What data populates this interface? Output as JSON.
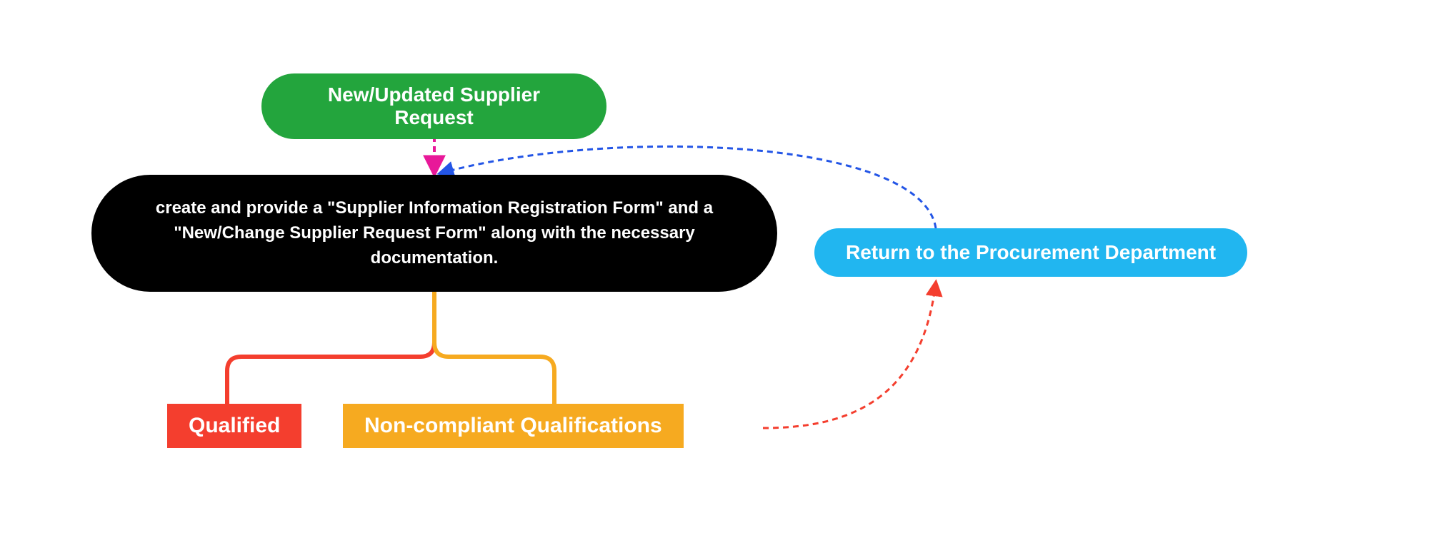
{
  "nodes": {
    "start": {
      "label": "New/Updated Supplier Request"
    },
    "create_forms": {
      "label": "create and provide a \"Supplier Information Registration Form\" and a \"New/Change Supplier Request Form\" along with the necessary documentation."
    },
    "qualified": {
      "label": "Qualified"
    },
    "noncompliant": {
      "label": "Non-compliant Qualifications"
    },
    "return_proc": {
      "label": "Return to the Procurement Department"
    }
  },
  "connectors": {
    "start_to_create": {
      "color": "#e81899",
      "dashed": true,
      "arrow": true
    },
    "create_to_qualified": {
      "color": "#f43e2e",
      "dashed": false,
      "arrow": false
    },
    "create_to_noncompliant": {
      "color": "#f6aa20",
      "dashed": false,
      "arrow": false
    },
    "noncompliant_to_return": {
      "color": "#f43e2e",
      "dashed": true,
      "arrow": true
    },
    "return_to_create": {
      "color": "#2355e6",
      "dashed": true,
      "arrow": true
    }
  },
  "colors": {
    "green": "#23a53d",
    "black": "#000000",
    "red": "#f43e2e",
    "orange": "#f6aa20",
    "blue": "#21b6f0",
    "magenta": "#e81899",
    "linkblue": "#2355e6"
  }
}
